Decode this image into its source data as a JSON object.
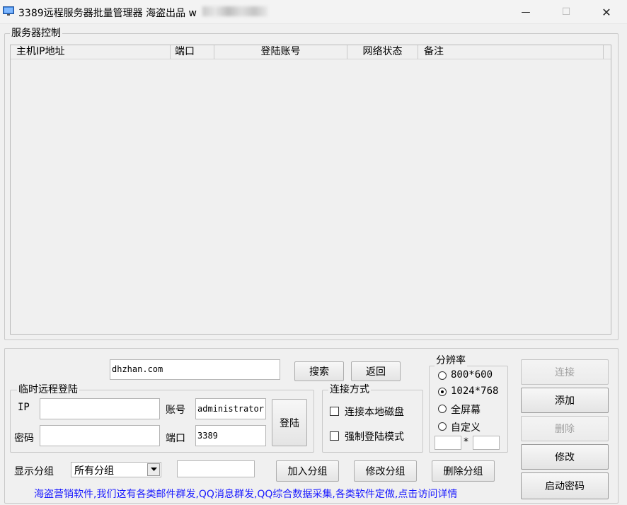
{
  "window": {
    "title": "3389远程服务器批量管理器 海盗出品 w",
    "minimize_glyph": "—",
    "maximize_glyph": "☐",
    "close_glyph": "✕"
  },
  "server_control": {
    "group_label": "服务器控制",
    "columns": [
      "主机IP地址",
      "端口",
      "登陆账号",
      "网络状态",
      "备注"
    ]
  },
  "search": {
    "value": "dhzhan.com",
    "search_label": "搜索",
    "back_label": "返回"
  },
  "temp_login": {
    "group_label": "临时远程登陆",
    "ip_label": "IP",
    "ip_value": "",
    "account_label": "账号",
    "account_value": "administrator",
    "password_label": "密码",
    "password_value": "",
    "port_label": "端口",
    "port_value": "3389",
    "login_label": "登陆"
  },
  "connect_mode": {
    "group_label": "连接方式",
    "local_disk_label": "连接本地磁盘",
    "local_disk_checked": false,
    "force_login_label": "强制登陆模式",
    "force_login_checked": false
  },
  "resolution": {
    "group_label": "分辨率",
    "options": [
      "800*600",
      "1024*768",
      "全屏幕",
      "自定义"
    ],
    "selected": "1024*768",
    "custom_sep": "*",
    "custom_width": "",
    "custom_height": ""
  },
  "actions": {
    "connect_label": "连接",
    "add_label": "添加",
    "delete_label": "删除",
    "modify_label": "修改",
    "start_password_label": "启动密码"
  },
  "groups": {
    "show_label": "显示分组",
    "selected": "所有分组",
    "group_name_value": "",
    "join_label": "加入分组",
    "modify_label": "修改分组",
    "delete_label": "删除分组"
  },
  "footer": {
    "link_text": "海盗营销软件,我们这有各类邮件群发,QQ消息群发,QQ综合数据采集,各类软件定做,点击访问详情",
    "link_color": "#1a1aff"
  }
}
